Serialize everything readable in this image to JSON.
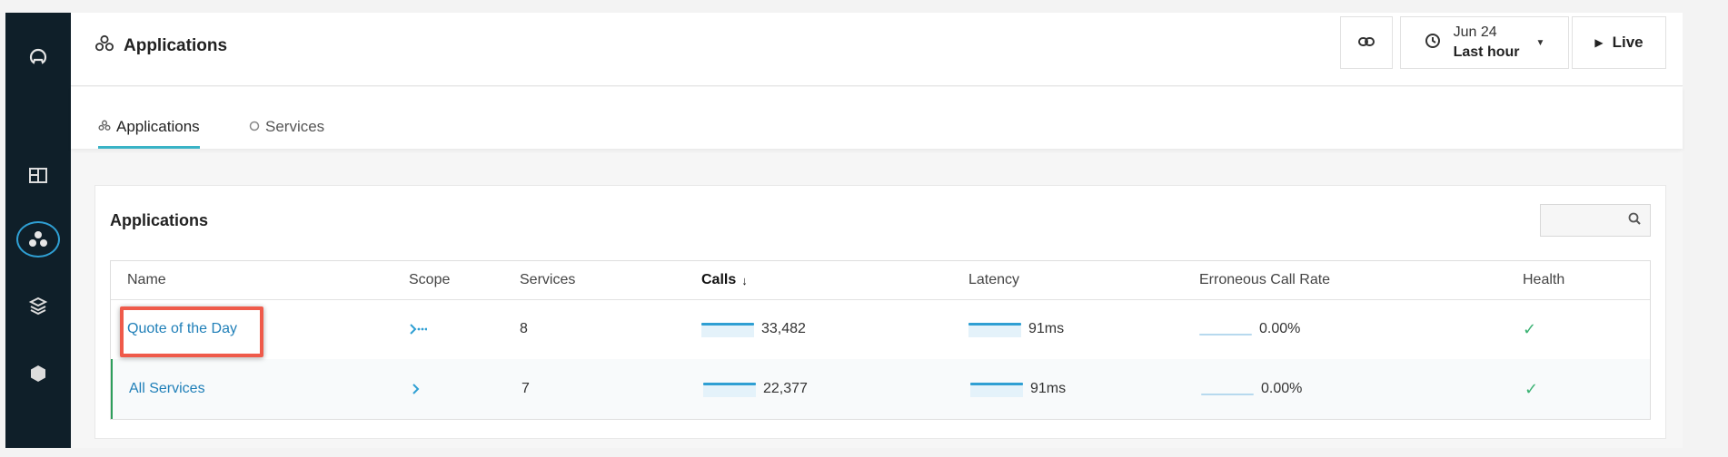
{
  "header": {
    "title": "Applications",
    "time_date": "Jun 24",
    "time_range": "Last hour",
    "live_label": "Live"
  },
  "tabs": [
    {
      "label": "Applications",
      "active": true
    },
    {
      "label": "Services",
      "active": false
    }
  ],
  "card": {
    "title": "Applications",
    "search_placeholder": ""
  },
  "table": {
    "columns": [
      "Name",
      "Scope",
      "Services",
      "Calls",
      "Latency",
      "Erroneous Call Rate",
      "Health"
    ],
    "sorted_column": "Calls",
    "rows": [
      {
        "name": "Quote of the Day",
        "services": "8",
        "calls": "33,482",
        "latency": "91ms",
        "error_rate": "0.00%",
        "health": "ok"
      },
      {
        "name": "All Services",
        "services": "7",
        "calls": "22,377",
        "latency": "91ms",
        "error_rate": "0.00%",
        "health": "ok"
      }
    ]
  },
  "colors": {
    "sidebar_bg": "#0f1f29",
    "accent": "#39b3c6",
    "link": "#1f7fb8",
    "health_ok": "#3bb273",
    "highlight": "#ef5a4a"
  }
}
